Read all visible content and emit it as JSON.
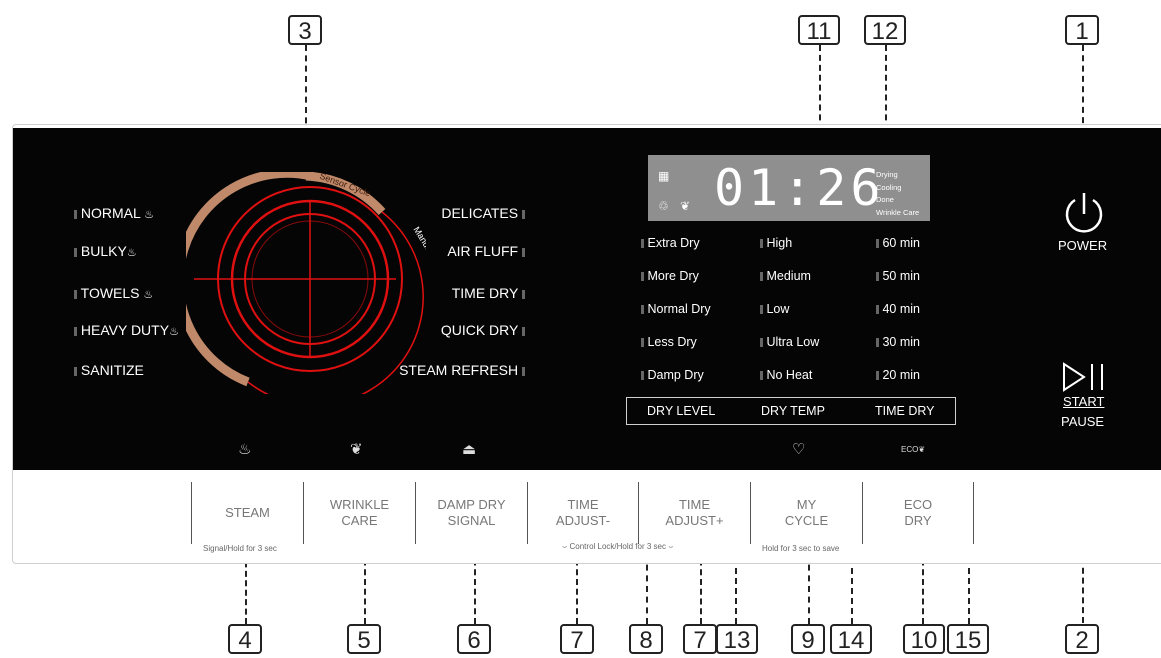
{
  "callouts": {
    "c1": "1",
    "c2": "2",
    "c3": "3",
    "c4": "4",
    "c5": "5",
    "c6": "6",
    "c7a": "7",
    "c7b": "7",
    "c8": "8",
    "c9": "9",
    "c10": "10",
    "c11": "11",
    "c12": "12",
    "c13": "13",
    "c14": "14",
    "c15": "15"
  },
  "dial": {
    "sensor_label": "Sensor Cycle",
    "manual_label": "Manual Cycle"
  },
  "programs_left": [
    "NORMAL",
    "BULKY",
    "TOWELS",
    "HEAVY DUTY",
    "SANITIZE"
  ],
  "programs_right": [
    "DELICATES",
    "AIR FLUFF",
    "TIME DRY",
    "QUICK DRY",
    "STEAM REFRESH"
  ],
  "display": {
    "time": "01:26",
    "statuses": [
      "Drying",
      "Cooling",
      "Done",
      "Wrinkle Care"
    ]
  },
  "dry_level": [
    "Extra Dry",
    "More Dry",
    "Normal Dry",
    "Less Dry",
    "Damp Dry"
  ],
  "dry_temp": [
    "High",
    "Medium",
    "Low",
    "Ultra Low",
    "No Heat"
  ],
  "time_dry": [
    "60 min",
    "50 min",
    "40 min",
    "30 min",
    "20 min"
  ],
  "selectors": {
    "dry_level": "DRY LEVEL",
    "dry_temp": "DRY TEMP",
    "time_dry": "TIME DRY"
  },
  "power": {
    "label": "POWER"
  },
  "start_pause": {
    "start": "START",
    "pause": "PAUSE"
  },
  "eco_icon_text": "ECO",
  "buttons": {
    "steam": [
      "STEAM"
    ],
    "wrinkle_care": [
      "WRINKLE",
      "CARE"
    ],
    "damp_dry_signal": [
      "DAMP DRY",
      "SIGNAL"
    ],
    "time_adjust_minus": [
      "TIME",
      "ADJUST-"
    ],
    "time_adjust_plus": [
      "TIME",
      "ADJUST+"
    ],
    "my_cycle": [
      "MY",
      "CYCLE"
    ],
    "eco_dry": [
      "ECO",
      "DRY"
    ]
  },
  "hints": {
    "signal_hold": "Signal/Hold for 3 sec",
    "control_lock": "Control Lock/Hold for 3 sec",
    "my_cycle_hold": "Hold for 3 sec to save"
  },
  "colors": {
    "panel": "#050505",
    "dial_ring": "#c08a6a",
    "dial_red": "#e01010",
    "display_bg": "#8f8f8f"
  }
}
